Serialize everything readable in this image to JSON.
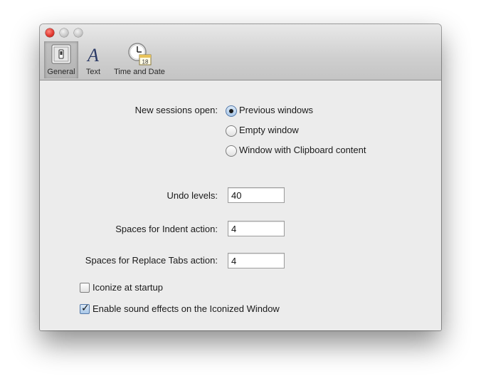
{
  "toolbar": {
    "items": [
      {
        "label": "General",
        "icon": "switch-icon",
        "selected": true
      },
      {
        "label": "Text",
        "icon": "text-icon",
        "selected": false
      },
      {
        "label": "Time and Date",
        "icon": "clock-calendar-icon",
        "selected": false
      }
    ],
    "calendar_day": "18"
  },
  "sessions": {
    "label": "New sessions open:",
    "options": [
      {
        "label": "Previous windows",
        "selected": true
      },
      {
        "label": "Empty window",
        "selected": false
      },
      {
        "label": "Window with Clipboard content",
        "selected": false
      }
    ]
  },
  "fields": {
    "undo": {
      "label": "Undo levels:",
      "value": "40"
    },
    "indent": {
      "label": "Spaces for Indent action:",
      "value": "4"
    },
    "replace_tabs": {
      "label": "Spaces for Replace Tabs action:",
      "value": "4"
    }
  },
  "checkboxes": {
    "iconize": {
      "label": "Iconize at startup",
      "checked": false
    },
    "sound": {
      "label": "Enable sound effects on the Iconized Window",
      "checked": true
    }
  },
  "colors": {
    "close_button": "#e0342c",
    "radio_selected": "#a9c7e8",
    "window_bg": "#ececec"
  }
}
